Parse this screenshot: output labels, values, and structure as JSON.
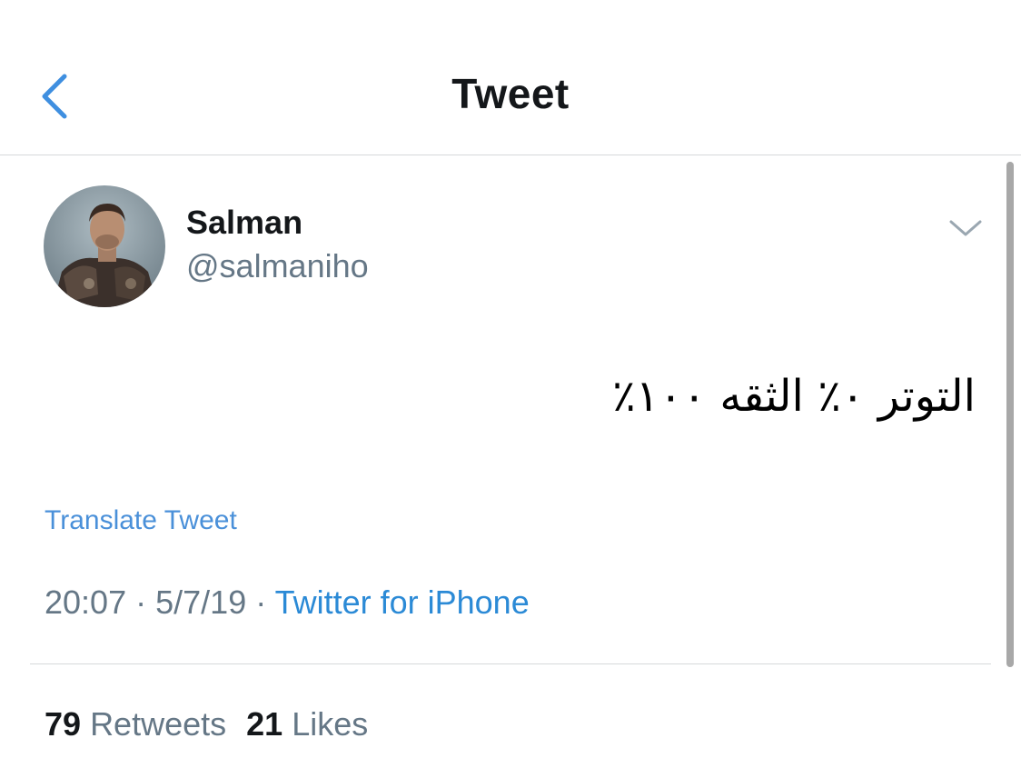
{
  "header": {
    "title": "Tweet",
    "back_icon": "chevron-left-icon"
  },
  "author": {
    "name": "Salman",
    "handle": "@salmaniho",
    "avatar": "user-avatar"
  },
  "tweet": {
    "text": "التوتر ٠٪ الثقه ١٠٠٪",
    "translate_label": "Translate Tweet",
    "time": "20:07",
    "separator": "·",
    "date": "5/7/19",
    "source": "Twitter for iPhone"
  },
  "stats": {
    "retweets_count": "79",
    "retweets_label": "Retweets",
    "likes_count": "21",
    "likes_label": "Likes"
  },
  "colors": {
    "accent": "#1da1f2",
    "secondary_text": "#657786",
    "primary_text": "#14171a",
    "divider": "#d6d9db"
  }
}
